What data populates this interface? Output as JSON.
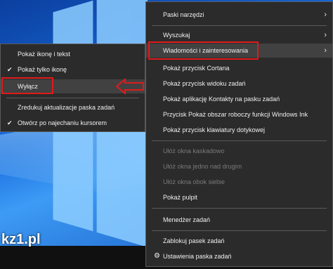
{
  "left_menu": {
    "items": [
      {
        "label": "Pokaż ikonę i tekst",
        "checked": false
      },
      {
        "label": "Pokaż tylko ikonę",
        "checked": true
      },
      {
        "label": "Wyłącz",
        "checked": false
      },
      {
        "label": "Zredukuj aktualizacje paska zadań",
        "checked": false
      },
      {
        "label": "Otwórz po najechaniu kursorem",
        "checked": true
      }
    ]
  },
  "right_menu": {
    "items": [
      {
        "label": "Paski narzędzi",
        "submenu": true,
        "disabled": false
      },
      {
        "label": "Wyszukaj",
        "submenu": true,
        "disabled": false
      },
      {
        "label": "Wiadomości i zainteresowania",
        "submenu": true,
        "disabled": false
      },
      {
        "label": "Pokaż przycisk Cortana",
        "submenu": false,
        "disabled": false
      },
      {
        "label": "Pokaż przycisk widoku zadań",
        "submenu": false,
        "disabled": false
      },
      {
        "label": "Pokaż aplikację Kontakty na pasku zadań",
        "submenu": false,
        "disabled": false
      },
      {
        "label": "Przycisk Pokaż obszar roboczy funkcji Windows Ink",
        "submenu": false,
        "disabled": false
      },
      {
        "label": "Pokaż przycisk klawiatury dotykowej",
        "submenu": false,
        "disabled": false
      },
      {
        "label": "Ułóż okna kaskadowo",
        "submenu": false,
        "disabled": true
      },
      {
        "label": "Ułóż okna jedno nad drugim",
        "submenu": false,
        "disabled": true
      },
      {
        "label": "Ułóż okna obok siebie",
        "submenu": false,
        "disabled": true
      },
      {
        "label": "Pokaż pulpit",
        "submenu": false,
        "disabled": false
      },
      {
        "label": "Menedżer zadań",
        "submenu": false,
        "disabled": false
      },
      {
        "label": "Zablokuj pasek zadań",
        "submenu": false,
        "disabled": false
      },
      {
        "label": "Ustawienia paska zadań",
        "submenu": false,
        "disabled": false
      }
    ]
  },
  "watermark": "kz1.pl",
  "icons": {
    "check": "check-icon",
    "chevron": "chevron-right-icon",
    "gear": "gear-icon",
    "arrow": "arrow-left-icon"
  },
  "colors": {
    "highlight": "#e01a1a",
    "menu_bg": "#2b2b2b"
  }
}
